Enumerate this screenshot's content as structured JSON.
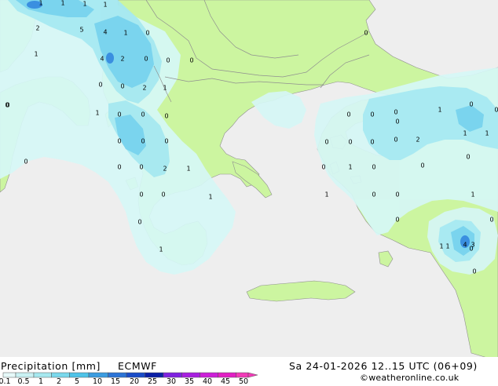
{
  "title": "Precipitation [mm]",
  "model": "ECMWF",
  "valid_time": "Sa 24-01-2026 12..15 UTC (06+09)",
  "credit": "©weatheronline.co.uk",
  "colors": {
    "sea": "#eeeeee",
    "land": "#ccf5a0",
    "precip_light": "#d6f7f6",
    "precip_medium": "#a6e9f1",
    "precip_heavy": "#7ad4ee",
    "precip_max": "#3a8fe0",
    "border": "#8f8f8f"
  },
  "legend": {
    "labels": [
      "0.1",
      "0.5",
      "1",
      "2",
      "5",
      "10",
      "15",
      "20",
      "25",
      "30",
      "35",
      "40",
      "45",
      "50"
    ],
    "colors": [
      "#e6f9f9",
      "#c9f1f3",
      "#a6e8ef",
      "#7ad8ec",
      "#4fc3e8",
      "#3b9ce0",
      "#2c74d6",
      "#1a4cc8",
      "#0a1fa6",
      "#7f22e0",
      "#a81fe0",
      "#cc1fd8",
      "#e21fc4",
      "#f23ab8"
    ]
  },
  "map_values": [
    {
      "v": "1"
    },
    {
      "v": "1"
    },
    {
      "v": "1"
    },
    {
      "v": "1"
    },
    {
      "v": "2"
    },
    {
      "v": "5"
    },
    {
      "v": "4"
    },
    {
      "v": "1"
    },
    {
      "v": "0"
    },
    {
      "v": "1"
    },
    {
      "v": "4"
    },
    {
      "v": "2"
    },
    {
      "v": "0"
    },
    {
      "v": "0"
    },
    {
      "v": "0"
    },
    {
      "v": "0"
    },
    {
      "v": "0"
    },
    {
      "v": "2"
    },
    {
      "v": "1"
    },
    {
      "v": "1"
    },
    {
      "v": "0"
    },
    {
      "v": "0"
    },
    {
      "v": "0"
    },
    {
      "v": "0"
    },
    {
      "v": "0"
    },
    {
      "v": "0"
    },
    {
      "v": "0"
    },
    {
      "v": "0"
    },
    {
      "v": "2"
    },
    {
      "v": "0"
    },
    {
      "v": "0"
    },
    {
      "v": "1"
    },
    {
      "v": "0"
    },
    {
      "v": "0"
    },
    {
      "v": "1"
    },
    {
      "v": "0"
    },
    {
      "v": "1"
    },
    {
      "v": "0"
    },
    {
      "v": "0"
    },
    {
      "v": "0"
    },
    {
      "v": "0"
    },
    {
      "v": "0"
    },
    {
      "v": "0"
    },
    {
      "v": "0"
    },
    {
      "v": "2"
    },
    {
      "v": "1"
    },
    {
      "v": "1"
    },
    {
      "v": "0"
    },
    {
      "v": "1"
    },
    {
      "v": "0"
    },
    {
      "v": "0"
    },
    {
      "v": "0"
    },
    {
      "v": "1"
    },
    {
      "v": "0"
    },
    {
      "v": "0"
    },
    {
      "v": "1"
    },
    {
      "v": "0"
    },
    {
      "v": "0"
    },
    {
      "v": "1"
    },
    {
      "v": "0"
    },
    {
      "v": "0"
    },
    {
      "v": "1"
    },
    {
      "v": "0"
    },
    {
      "v": "0"
    },
    {
      "v": "0"
    },
    {
      "v": "0"
    },
    {
      "v": "1"
    },
    {
      "v": "4"
    },
    {
      "v": "3"
    },
    {
      "v": "0"
    }
  ]
}
